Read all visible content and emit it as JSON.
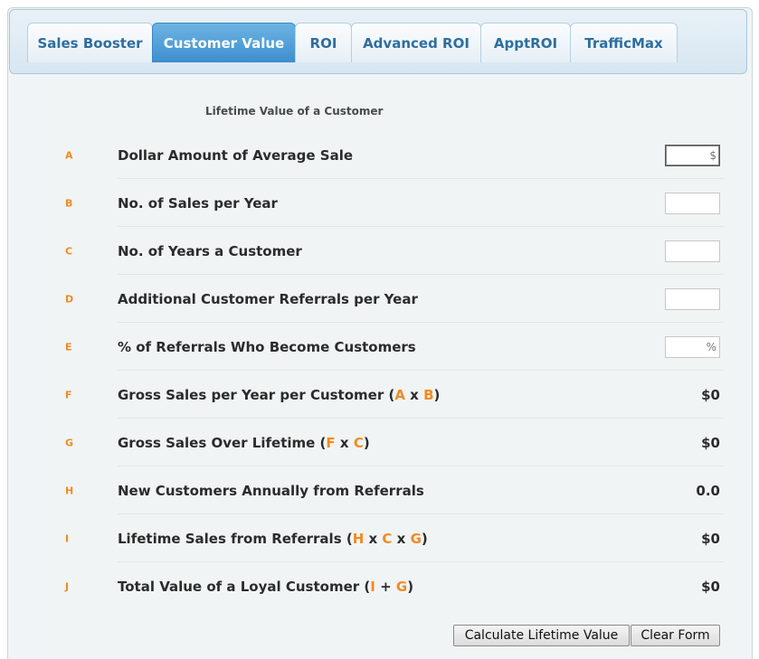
{
  "tabs": [
    {
      "label": "Sales Booster",
      "active": false
    },
    {
      "label": "Customer Value",
      "active": true
    },
    {
      "label": "ROI",
      "active": false
    },
    {
      "label": "Advanced ROI",
      "active": false
    },
    {
      "label": "ApptROI",
      "active": false
    },
    {
      "label": "TrafficMax",
      "active": false
    }
  ],
  "form": {
    "title": "Lifetime Value of a Customer",
    "rows": {
      "a": {
        "letter": "A",
        "label": "Dollar Amount of Average Sale",
        "placeholder": "$"
      },
      "b": {
        "letter": "B",
        "label": "No. of Sales per Year",
        "placeholder": ""
      },
      "c": {
        "letter": "C",
        "label": "No. of Years a Customer",
        "placeholder": ""
      },
      "d": {
        "letter": "D",
        "label": "Additional Customer Referrals per Year",
        "placeholder": ""
      },
      "e": {
        "letter": "E",
        "label": "% of Referrals Who Become Customers",
        "placeholder": "%"
      },
      "f": {
        "letter": "F",
        "label": "Gross Sales per Year per Customer",
        "ref1": "A",
        "op1": "x",
        "ref2": "B",
        "value": "$0"
      },
      "g": {
        "letter": "G",
        "label": "Gross Sales Over Lifetime",
        "ref1": "F",
        "op1": "x",
        "ref2": "C",
        "value": "$0"
      },
      "h": {
        "letter": "H",
        "label": "New Customers Annually from Referrals",
        "value": "0.0"
      },
      "i": {
        "letter": "I",
        "label": "Lifetime Sales from Referrals",
        "ref1": "H",
        "op1": "x",
        "ref2": "C",
        "op2": "x",
        "ref3": "G",
        "value": "$0"
      },
      "j": {
        "letter": "J",
        "label": "Total Value of a Loyal Customer",
        "ref1": "I",
        "op1": "+",
        "ref2": "G",
        "value": "$0"
      }
    }
  },
  "buttons": {
    "calculate": "Calculate Lifetime Value",
    "clear": "Clear Form"
  }
}
